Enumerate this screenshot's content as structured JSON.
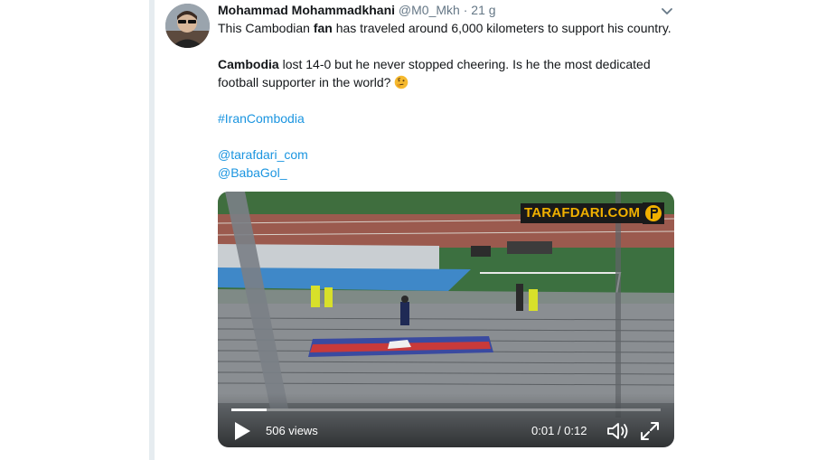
{
  "tweet": {
    "author_name": "Mohammad Mohammadkhani",
    "author_handle": "@M0_Mkh",
    "separator": "·",
    "time": "21 g",
    "line1_before": "This Cambodian ",
    "line1_bold": "fan",
    "line1_after": " has traveled around 6,000 kilometers to support his country.",
    "line2_bold": "Cambodia",
    "line2_after": " lost 14-0 but he never stopped cheering. Is he the most dedicated",
    "line3": "football supporter in the world?",
    "emoji": "thinking-face",
    "hashtag": "#IranCombodia",
    "mention1": "@tarafdari_com",
    "mention2": "@BabaGol_"
  },
  "video": {
    "watermark": "TARAFDARI.COM",
    "views": "506 views",
    "timecode": "0:01 / 0:12",
    "progress_fraction": 0.083
  },
  "icons": {
    "menu": "chevron-down-icon",
    "play": "play-icon",
    "volume": "volume-icon",
    "fullscreen": "fullscreen-icon"
  },
  "colors": {
    "link": "#1b95e0",
    "secondary_text": "#657786",
    "watermark_text": "#f0b000"
  }
}
